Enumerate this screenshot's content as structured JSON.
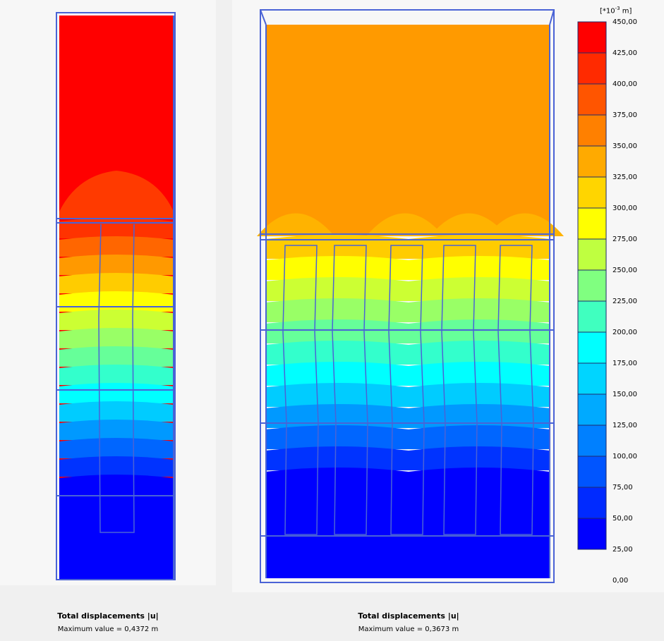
{
  "left_plot": {
    "title": "Total displacements |u|",
    "max_value_text": "Maximum value = 0,4372 m"
  },
  "right_plot": {
    "title": "Total displacements |u|",
    "max_value_text": "Maximum value = 0,3673 m"
  },
  "legend": {
    "unit_prefix": "[*10",
    "unit_exp": "-3",
    "unit_suffix": " m]",
    "labels": [
      "450,00",
      "425,00",
      "400,00",
      "375,00",
      "350,00",
      "325,00",
      "300,00",
      "275,00",
      "250,00",
      "225,00",
      "200,00",
      "175,00",
      "150,00",
      "125,00",
      "100,00",
      "75,00",
      "50,00",
      "25,00",
      "0,00"
    ],
    "colors": [
      "#ff0000",
      "#ff2a00",
      "#ff5500",
      "#ff8000",
      "#ffaa00",
      "#ffd500",
      "#ffff00",
      "#bfff40",
      "#80ff80",
      "#40ffbf",
      "#00ffff",
      "#00d5ff",
      "#00aaff",
      "#0080ff",
      "#0055ff",
      "#002aff",
      "#0000ff"
    ]
  },
  "colors": {
    "band_colors": [
      "#ff0000",
      "#ff3300",
      "#ff6600",
      "#ff9900",
      "#ffcc00",
      "#ffff00",
      "#ccff33",
      "#99ff66",
      "#66ff99",
      "#33ffcc",
      "#00ffff",
      "#00ccff",
      "#0099ff",
      "#0066ff",
      "#0033ff",
      "#0000ff"
    ],
    "wireframe": "#4a63d6",
    "top_orange": "#ff9a00"
  }
}
